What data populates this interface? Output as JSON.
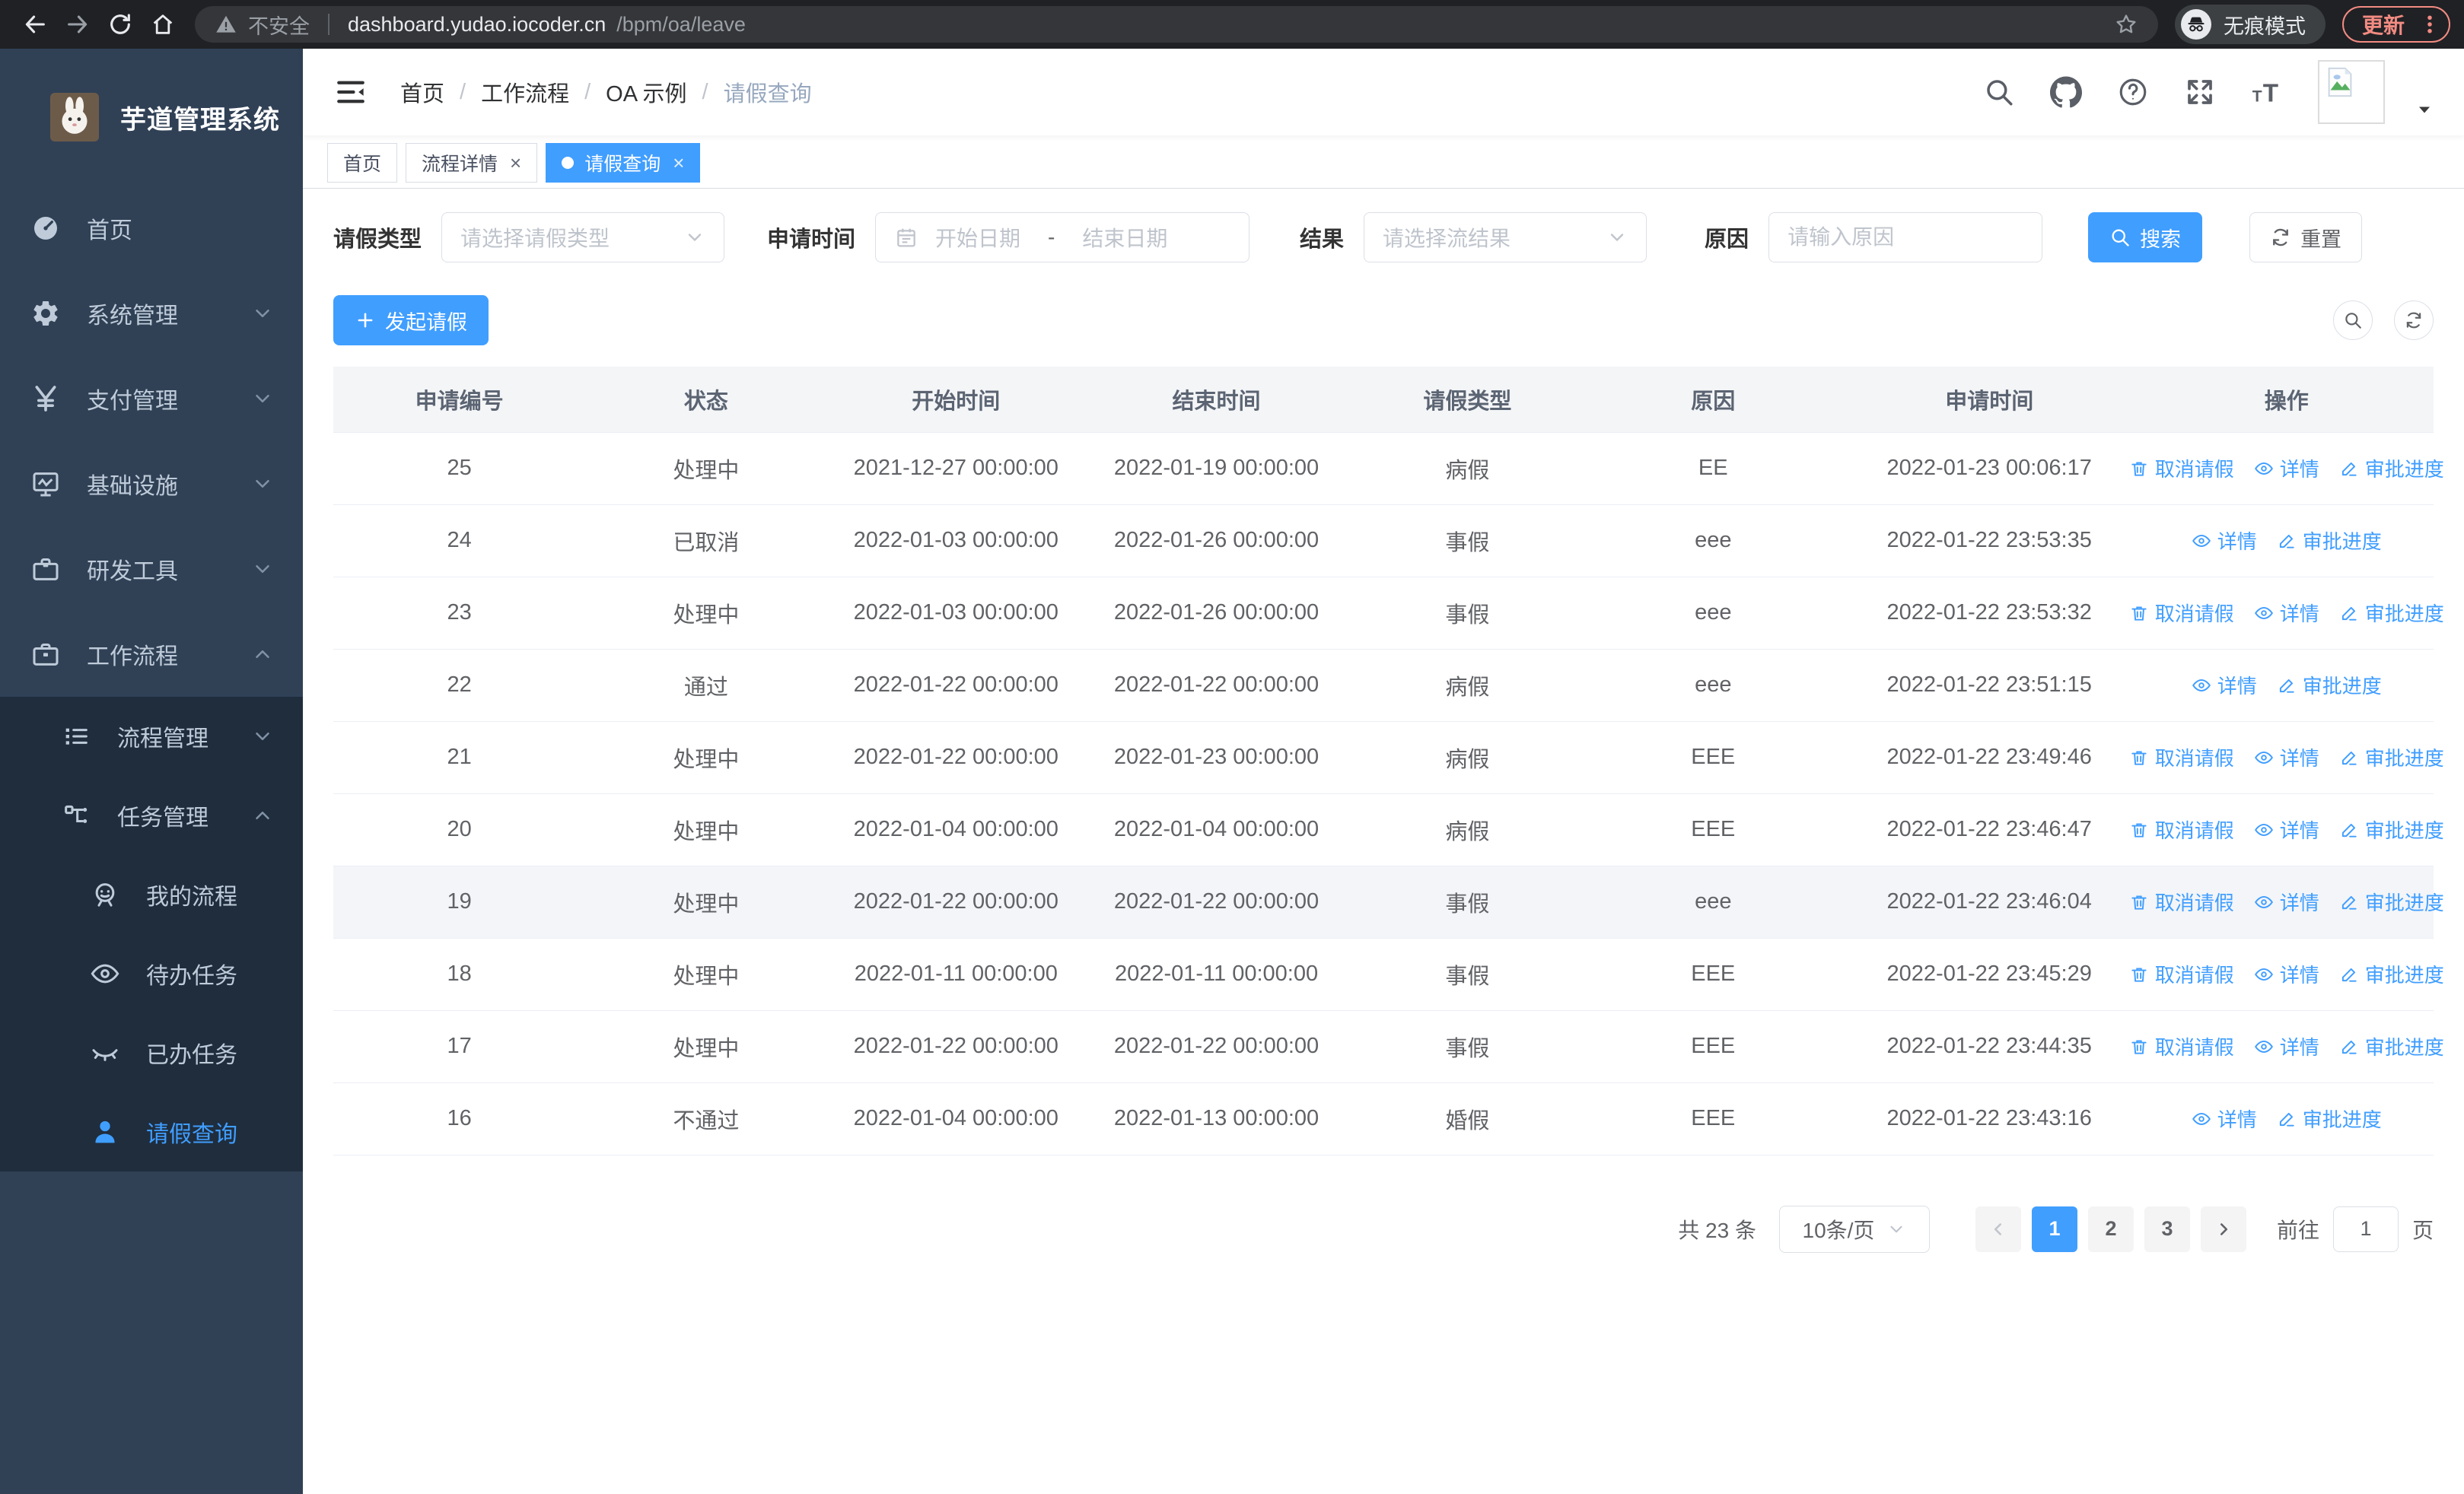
{
  "browser": {
    "security_warning": "不安全",
    "url_host": "dashboard.yudao.iocoder.cn",
    "url_path": "/bpm/oa/leave",
    "incognito_label": "无痕模式",
    "update_label": "更新"
  },
  "sidebar": {
    "app_title": "芋道管理系统",
    "items": [
      {
        "id": "home",
        "label": "首页",
        "icon": "dashboard-icon",
        "level": 1,
        "submenu": false,
        "chevron": null,
        "active": false
      },
      {
        "id": "system-mgmt",
        "label": "系统管理",
        "icon": "gear-icon",
        "level": 1,
        "submenu": false,
        "chevron": "down",
        "active": false
      },
      {
        "id": "payment-mgmt",
        "label": "支付管理",
        "icon": "yen-icon",
        "level": 1,
        "submenu": false,
        "chevron": "down",
        "active": false
      },
      {
        "id": "infrastructure",
        "label": "基础设施",
        "icon": "monitor-icon",
        "level": 1,
        "submenu": false,
        "chevron": "down",
        "active": false
      },
      {
        "id": "dev-tools",
        "label": "研发工具",
        "icon": "toolbox-icon",
        "level": 1,
        "submenu": false,
        "chevron": "down",
        "active": false
      },
      {
        "id": "workflow",
        "label": "工作流程",
        "icon": "briefcase-icon",
        "level": 1,
        "submenu": false,
        "chevron": "up",
        "active": false
      },
      {
        "id": "process-mgmt",
        "label": "流程管理",
        "icon": "list-icon",
        "level": 2,
        "submenu": true,
        "chevron": "down",
        "active": false
      },
      {
        "id": "task-mgmt",
        "label": "任务管理",
        "icon": "flow-icon",
        "level": 2,
        "submenu": true,
        "chevron": "up",
        "active": false
      },
      {
        "id": "my-process",
        "label": "我的流程",
        "icon": "robot-icon",
        "level": 3,
        "submenu": true,
        "chevron": null,
        "active": false
      },
      {
        "id": "todo-task",
        "label": "待办任务",
        "icon": "eye-open-icon",
        "level": 3,
        "submenu": true,
        "chevron": null,
        "active": false
      },
      {
        "id": "done-task",
        "label": "已办任务",
        "icon": "eye-closed-icon",
        "level": 3,
        "submenu": true,
        "chevron": null,
        "active": false
      },
      {
        "id": "leave-query",
        "label": "请假查询",
        "icon": "user-icon",
        "level": 3,
        "submenu": true,
        "chevron": null,
        "active": true
      }
    ]
  },
  "navbar": {
    "breadcrumb": [
      "首页",
      "工作流程",
      "OA 示例",
      "请假查询"
    ],
    "icons": [
      "search-icon",
      "github-icon",
      "help-icon",
      "fullscreen-icon",
      "font-size-icon"
    ]
  },
  "tabs": [
    {
      "label": "首页",
      "closable": false,
      "active": false
    },
    {
      "label": "流程详情",
      "closable": true,
      "active": false
    },
    {
      "label": "请假查询",
      "closable": true,
      "active": true
    }
  ],
  "filters": {
    "leave_type": {
      "label": "请假类型",
      "placeholder": "请选择请假类型"
    },
    "apply_time": {
      "label": "申请时间",
      "start_placeholder": "开始日期",
      "separator": "-",
      "end_placeholder": "结束日期"
    },
    "result": {
      "label": "结果",
      "placeholder": "请选择流结果"
    },
    "reason": {
      "label": "原因",
      "placeholder": "请输入原因"
    },
    "search_label": "搜索",
    "reset_label": "重置"
  },
  "toolbar": {
    "create_label": "发起请假"
  },
  "table": {
    "columns": [
      "申请编号",
      "状态",
      "开始时间",
      "结束时间",
      "请假类型",
      "原因",
      "申请时间",
      "操作"
    ],
    "action_labels": {
      "cancel": "取消请假",
      "detail": "详情",
      "progress": "审批进度"
    },
    "rows": [
      {
        "id": "25",
        "status": "处理中",
        "start": "2021-12-27 00:00:00",
        "end": "2022-01-19 00:00:00",
        "type": "病假",
        "reason": "EE",
        "apply_time": "2022-01-23 00:06:17",
        "actions": [
          "cancel",
          "detail",
          "progress"
        ],
        "highlighted": false
      },
      {
        "id": "24",
        "status": "已取消",
        "start": "2022-01-03 00:00:00",
        "end": "2022-01-26 00:00:00",
        "type": "事假",
        "reason": "eee",
        "apply_time": "2022-01-22 23:53:35",
        "actions": [
          "detail",
          "progress"
        ],
        "highlighted": false
      },
      {
        "id": "23",
        "status": "处理中",
        "start": "2022-01-03 00:00:00",
        "end": "2022-01-26 00:00:00",
        "type": "事假",
        "reason": "eee",
        "apply_time": "2022-01-22 23:53:32",
        "actions": [
          "cancel",
          "detail",
          "progress"
        ],
        "highlighted": false
      },
      {
        "id": "22",
        "status": "通过",
        "start": "2022-01-22 00:00:00",
        "end": "2022-01-22 00:00:00",
        "type": "病假",
        "reason": "eee",
        "apply_time": "2022-01-22 23:51:15",
        "actions": [
          "detail",
          "progress"
        ],
        "highlighted": false
      },
      {
        "id": "21",
        "status": "处理中",
        "start": "2022-01-22 00:00:00",
        "end": "2022-01-23 00:00:00",
        "type": "病假",
        "reason": "EEE",
        "apply_time": "2022-01-22 23:49:46",
        "actions": [
          "cancel",
          "detail",
          "progress"
        ],
        "highlighted": false
      },
      {
        "id": "20",
        "status": "处理中",
        "start": "2022-01-04 00:00:00",
        "end": "2022-01-04 00:00:00",
        "type": "病假",
        "reason": "EEE",
        "apply_time": "2022-01-22 23:46:47",
        "actions": [
          "cancel",
          "detail",
          "progress"
        ],
        "highlighted": false
      },
      {
        "id": "19",
        "status": "处理中",
        "start": "2022-01-22 00:00:00",
        "end": "2022-01-22 00:00:00",
        "type": "事假",
        "reason": "eee",
        "apply_time": "2022-01-22 23:46:04",
        "actions": [
          "cancel",
          "detail",
          "progress"
        ],
        "highlighted": true
      },
      {
        "id": "18",
        "status": "处理中",
        "start": "2022-01-11 00:00:00",
        "end": "2022-01-11 00:00:00",
        "type": "事假",
        "reason": "EEE",
        "apply_time": "2022-01-22 23:45:29",
        "actions": [
          "cancel",
          "detail",
          "progress"
        ],
        "highlighted": false
      },
      {
        "id": "17",
        "status": "处理中",
        "start": "2022-01-22 00:00:00",
        "end": "2022-01-22 00:00:00",
        "type": "事假",
        "reason": "EEE",
        "apply_time": "2022-01-22 23:44:35",
        "actions": [
          "cancel",
          "detail",
          "progress"
        ],
        "highlighted": false
      },
      {
        "id": "16",
        "status": "不通过",
        "start": "2022-01-04 00:00:00",
        "end": "2022-01-13 00:00:00",
        "type": "婚假",
        "reason": "EEE",
        "apply_time": "2022-01-22 23:43:16",
        "actions": [
          "detail",
          "progress"
        ],
        "highlighted": false
      }
    ]
  },
  "pagination": {
    "total_text": "共 23 条",
    "page_size": "10条/页",
    "pages": [
      "1",
      "2",
      "3"
    ],
    "active_page": "1",
    "goto_label": "前往",
    "goto_value": "1",
    "page_suffix": "页"
  },
  "colors": {
    "accent": "#409eff",
    "sidebar_bg": "#304156",
    "submenu_bg": "#1f2d3d",
    "update_accent": "#f28b82"
  }
}
